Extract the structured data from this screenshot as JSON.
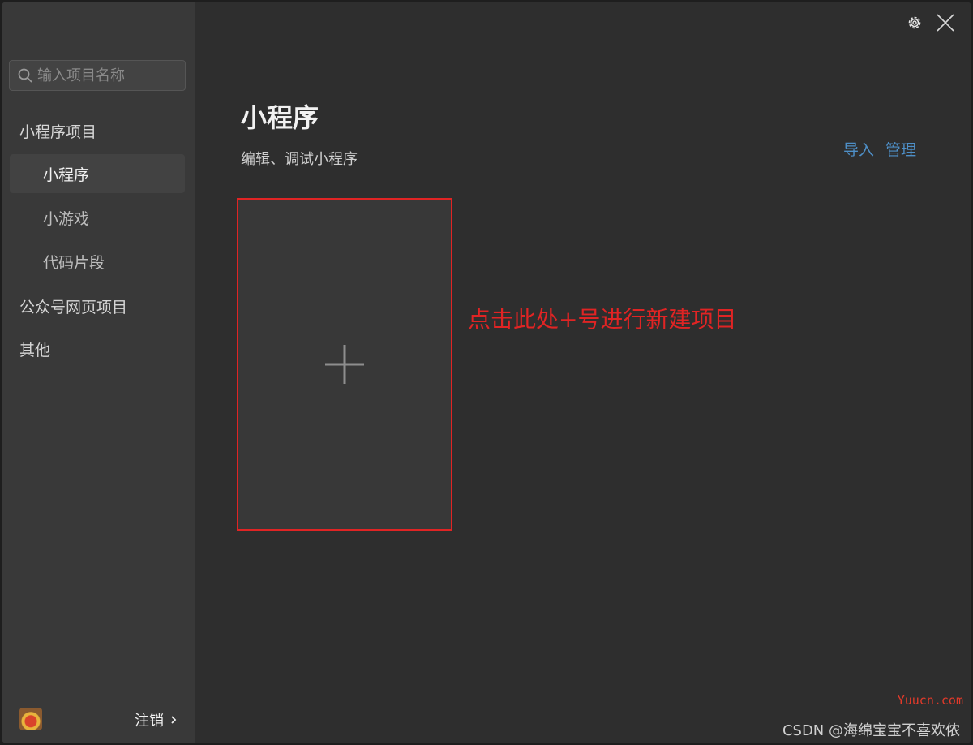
{
  "sidebar": {
    "search_placeholder": "输入项目名称",
    "groups": [
      {
        "label": "小程序项目"
      },
      {
        "label": "公众号网页项目"
      },
      {
        "label": "其他"
      }
    ],
    "items": [
      {
        "label": "小程序",
        "active": true
      },
      {
        "label": "小游戏",
        "active": false
      },
      {
        "label": "代码片段",
        "active": false
      }
    ],
    "footer": {
      "logout_label": "注销"
    }
  },
  "main": {
    "title": "小程序",
    "subtitle": "编辑、调试小程序",
    "actions": {
      "import_label": "导入",
      "manage_label": "管理"
    },
    "annotation": "点击此处+号进行新建项目"
  },
  "watermarks": {
    "site": "Yuucn.com",
    "author": "CSDN @海绵宝宝不喜欢侬"
  },
  "colors": {
    "accent_link": "#4e8fc7",
    "highlight_red": "#e02424",
    "sidebar_bg": "#393939",
    "main_bg": "#2e2e2e"
  },
  "icons": [
    "search-icon",
    "gear-icon",
    "close-icon",
    "plus-icon",
    "chevron-right-icon"
  ]
}
